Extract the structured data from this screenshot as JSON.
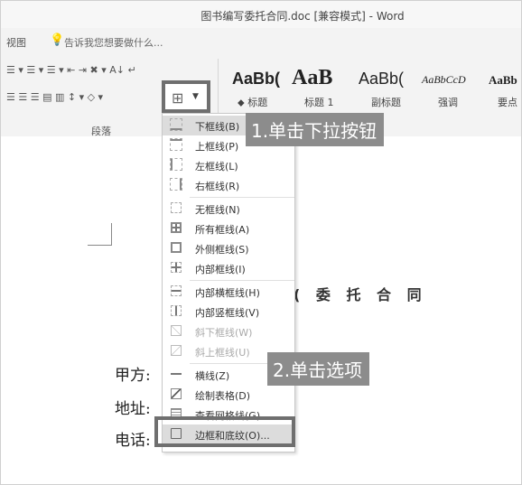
{
  "window": {
    "title": "图书编写委托合同.doc [兼容模式] - Word"
  },
  "tell_me": {
    "tab_view": "视图",
    "placeholder": "告诉我您想要做什么..."
  },
  "ribbon": {
    "row1": "☰ ▾ ☰ ▾ ☰ ▾   ⇤ ⇥   ✖ ▾   A↓   ↵",
    "row2": "☰ ☰ ☰ ▤ ▥   ↕ ▾   ◇ ▾",
    "group_label": "段落",
    "styles": [
      {
        "sample": "AaBb(",
        "name": "⬥ 标题"
      },
      {
        "sample": "AaB",
        "name": "标题 1"
      },
      {
        "sample": "AaBb(",
        "name": "副标题"
      },
      {
        "sample": "AaBbCcD",
        "name": "强调"
      },
      {
        "sample": "AaBb",
        "name": "要点"
      }
    ]
  },
  "border_menu": {
    "items": [
      {
        "label": "下框线(B)",
        "icon": "bottom-border-icon"
      },
      {
        "label": "上框线(P)",
        "icon": "top-border-icon"
      },
      {
        "label": "左框线(L)",
        "icon": "left-border-icon"
      },
      {
        "label": "右框线(R)",
        "icon": "right-border-icon"
      },
      {
        "label": "无框线(N)",
        "icon": "no-border-icon"
      },
      {
        "label": "所有框线(A)",
        "icon": "all-borders-icon"
      },
      {
        "label": "外侧框线(S)",
        "icon": "outside-borders-icon"
      },
      {
        "label": "内部框线(I)",
        "icon": "inside-borders-icon"
      },
      {
        "label": "内部横框线(H)",
        "icon": "inside-horizontal-border-icon"
      },
      {
        "label": "内部竖框线(V)",
        "icon": "inside-vertical-border-icon"
      },
      {
        "label": "斜下框线(W)",
        "icon": "diagonal-down-border-icon"
      },
      {
        "label": "斜上框线(U)",
        "icon": "diagonal-up-border-icon"
      },
      {
        "label": "横线(Z)",
        "icon": "horizontal-line-icon"
      },
      {
        "label": "绘制表格(D)",
        "icon": "draw-table-icon"
      },
      {
        "label": "查看网格线(G)",
        "icon": "view-gridlines-icon"
      },
      {
        "label": "边框和底纹(O)...",
        "icon": "borders-shading-icon"
      }
    ]
  },
  "callouts": {
    "step1": "1.单击下拉按钮",
    "step2": "2.单击选项"
  },
  "document": {
    "heading_fragment": "( 委 托 合 同",
    "party_a": "甲方:",
    "address": "地址:",
    "phone": "电话:"
  }
}
